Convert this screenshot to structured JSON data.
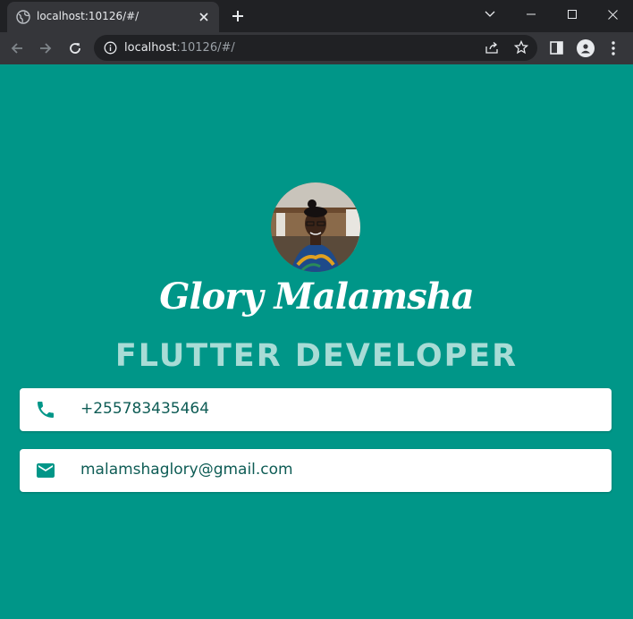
{
  "browser": {
    "tab_title": "localhost:10126/#/",
    "url_host": "localhost",
    "url_rest": ":10126/#/"
  },
  "profile": {
    "name": "Glory Malamsha",
    "role": "FLUTTER DEVELOPER",
    "phone": "+255783435464",
    "email": "malamshaglory@gmail.com"
  },
  "colors": {
    "background": "#009688",
    "role_text": "#a8dcd6",
    "card_text": "#0e5c55",
    "icon": "#009688"
  }
}
